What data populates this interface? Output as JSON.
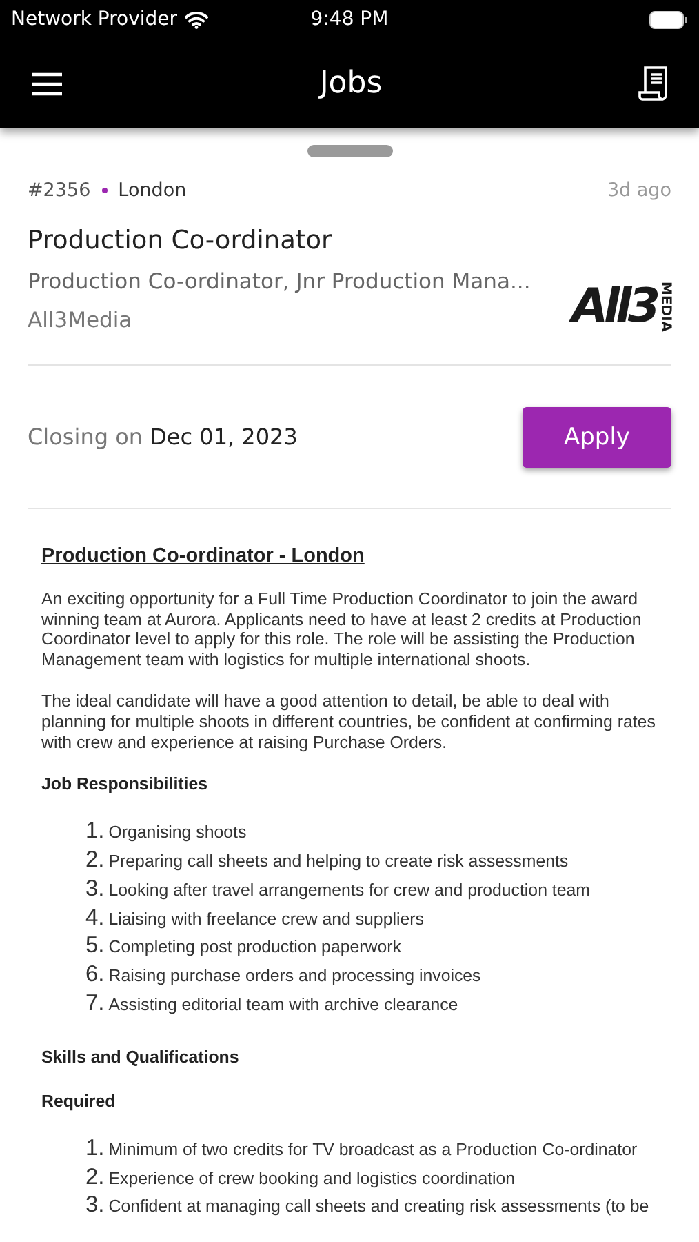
{
  "status_bar": {
    "carrier": "Network Provider",
    "time": "9:48 PM"
  },
  "nav_bar": {
    "title": "Jobs"
  },
  "job": {
    "number": "#2356",
    "location": "London",
    "posted": "3d ago",
    "title": "Production Co-ordinator",
    "roles": "Production Co-ordinator, Jnr Production Mana...",
    "company": "All3Media",
    "logo": {
      "mark": "All3",
      "sub": "MEDIA"
    },
    "closing_label": "Closing on",
    "closing_date": "Dec 01, 2023",
    "apply_button": "Apply"
  },
  "description": {
    "heading": "Production Co-ordinator - London",
    "blocks": [
      {
        "kind": "paragraph",
        "text": "An exciting opportunity for a Full Time Production Coordinator to join the award winning team at Aurora. Applicants need to have at least 2 credits at Production Coordinator level to apply for this role. The role will be assisting the Production Management team with logistics for multiple international shoots."
      },
      {
        "kind": "paragraph",
        "text": "The ideal candidate will have a good attention to detail, be able to deal with planning for multiple shoots in different countries, be confident at confirming rates with crew and experience at raising Purchase Orders."
      },
      {
        "kind": "subheading",
        "text": "Job Responsibilities"
      },
      {
        "kind": "list",
        "items": [
          {
            "number": "1.",
            "text": "Organising shoots"
          },
          {
            "number": "2.",
            "text": "Preparing call sheets and helping to create risk assessments"
          },
          {
            "number": "3.",
            "text": "Looking after travel arrangements for crew and production team"
          },
          {
            "number": "4.",
            "text": "Liaising with freelance crew and suppliers"
          },
          {
            "number": "5.",
            "text": "Completing post production paperwork"
          },
          {
            "number": "6.",
            "text": "Raising purchase orders and processing invoices"
          },
          {
            "number": "7.",
            "text": "Assisting editorial team with archive clearance"
          }
        ]
      },
      {
        "kind": "subheading",
        "text": "Skills and Qualifications"
      },
      {
        "kind": "subheading",
        "text": "Required"
      },
      {
        "kind": "list",
        "items": [
          {
            "number": "1.",
            "text": "Minimum of two credits for TV broadcast as a Production Co-ordinator"
          },
          {
            "number": "2.",
            "text": "Experience of crew booking and logistics coordination"
          },
          {
            "number": "3.",
            "text": "Confident at managing call sheets and creating risk assessments (to be"
          }
        ]
      }
    ]
  }
}
